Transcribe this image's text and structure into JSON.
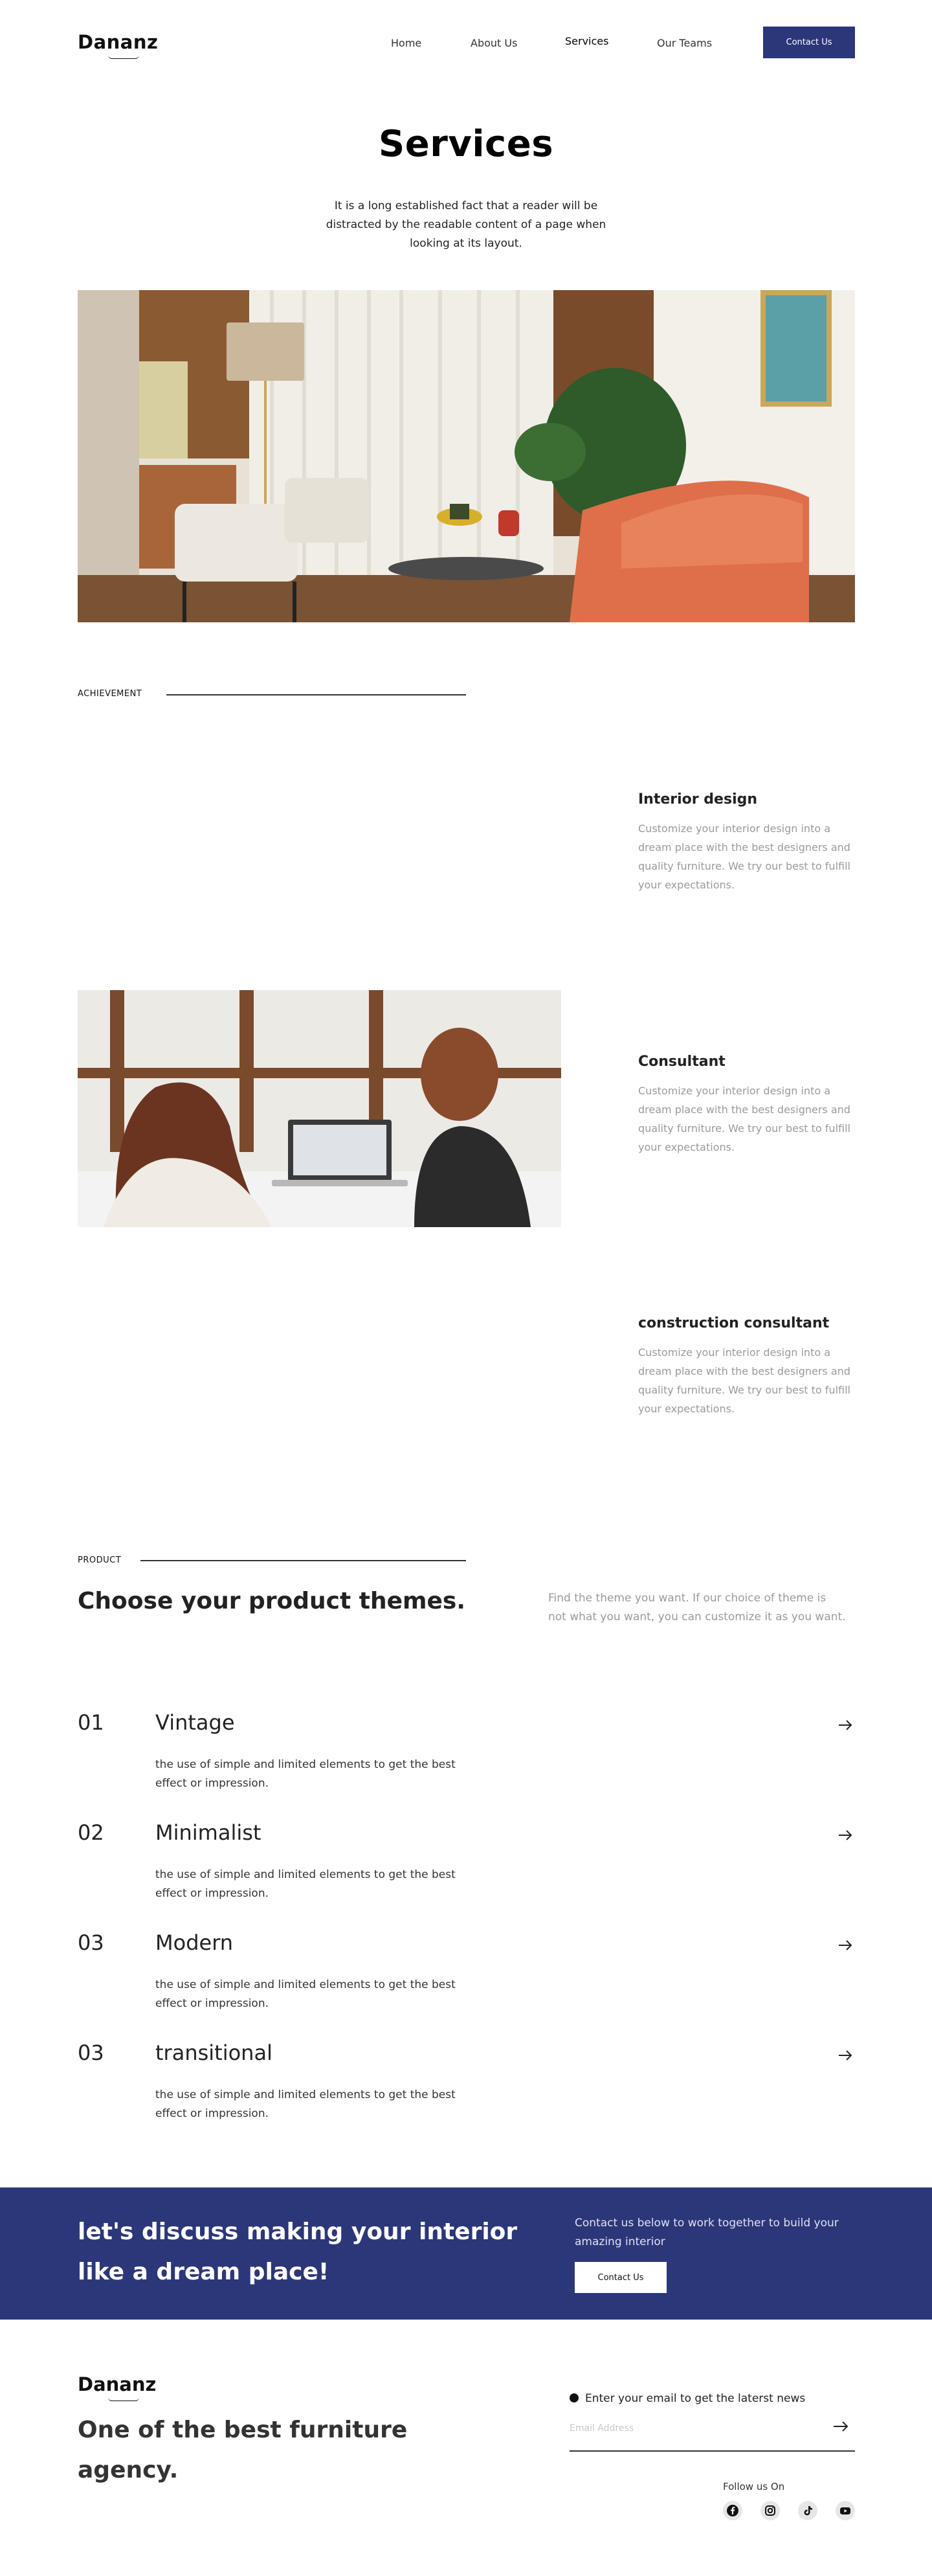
{
  "brand": {
    "name": "Dananz"
  },
  "nav": {
    "links": [
      "Home",
      "About Us",
      "Services",
      "Our Teams"
    ],
    "active": "Services",
    "contact_label": "Contact Us"
  },
  "hero": {
    "title": "Services",
    "description": "It is a long established fact that a reader will be distracted by the readable content of a page when looking at its layout."
  },
  "achievement": {
    "label": "ACHIEVEMENT",
    "services": [
      {
        "title": "Interior design",
        "description": "Customize your interior design into a dream place with the best designers and quality furniture. We try our best to fulfill your expectations."
      },
      {
        "title": "Consultant",
        "description": "Customize your interior design into a dream place with the best designers and quality furniture. We try our best to fulfill your expectations."
      },
      {
        "title": "construction consultant",
        "description": "Customize your interior design into a dream place with the best designers and quality furniture. We try our best to fulfill your expectations."
      }
    ]
  },
  "product": {
    "label": "PRODUCT",
    "title": "Choose your product themes.",
    "description": "Find the theme you want. If our choice of theme is not what you want, you can customize it as you want.",
    "items": [
      {
        "num": "01",
        "name": "Vintage",
        "description": "the use of simple and limited elements to get the best effect or impression."
      },
      {
        "num": "02",
        "name": "Minimalist",
        "description": "the use of simple and limited elements to get the best effect or impression."
      },
      {
        "num": "03",
        "name": "Modern",
        "description": "the use of simple and limited elements to get the best effect or impression."
      },
      {
        "num": "03",
        "name": "transitional",
        "description": "the use of simple and limited elements to get the best effect or impression."
      }
    ]
  },
  "cta": {
    "title": "let's discuss making your interior like a dream place!",
    "description": "Contact us below to work together to build your amazing interior",
    "button_label": "Contact Us"
  },
  "footer": {
    "tagline": "One of the best furniture agency.",
    "newsletter_label": "Enter  your email to get the laterst news",
    "email_placeholder": "Email Address",
    "follow_label": "Follow us On",
    "social": [
      "facebook-icon",
      "instagram-icon",
      "tiktok-icon",
      "youtube-icon"
    ]
  },
  "colors": {
    "accent": "#2c3779",
    "muted_text": "#9a9a9a",
    "text": "#222222"
  }
}
